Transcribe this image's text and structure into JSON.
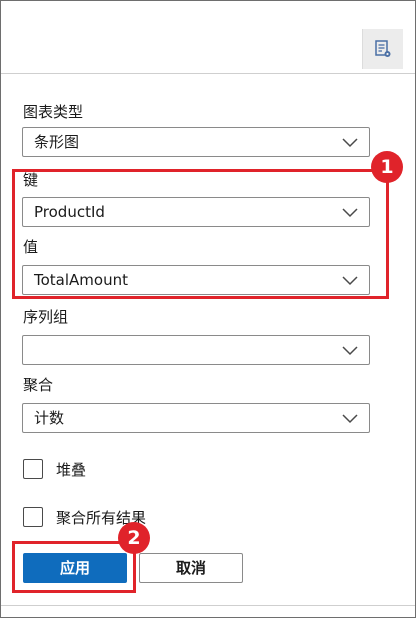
{
  "fields": {
    "chart_type": {
      "label": "图表类型",
      "value": "条形图"
    },
    "key": {
      "label": "键",
      "value": "ProductId"
    },
    "value": {
      "label": "值",
      "value": "TotalAmount"
    },
    "series_group": {
      "label": "序列组",
      "value": ""
    },
    "aggregate": {
      "label": "聚合",
      "value": "计数"
    }
  },
  "checkboxes": {
    "stacked": {
      "label": "堆叠",
      "checked": false
    },
    "aggregate_all": {
      "label": "聚合所有结果",
      "checked": false
    }
  },
  "buttons": {
    "apply": "应用",
    "cancel": "取消"
  },
  "annotations": {
    "badge1": "1",
    "badge2": "2"
  },
  "colors": {
    "highlight": "#e0232a",
    "primary": "#0f6cbd"
  },
  "icons": {
    "toolbar": "chart-settings-icon",
    "dropdown": "chevron-down-icon"
  }
}
